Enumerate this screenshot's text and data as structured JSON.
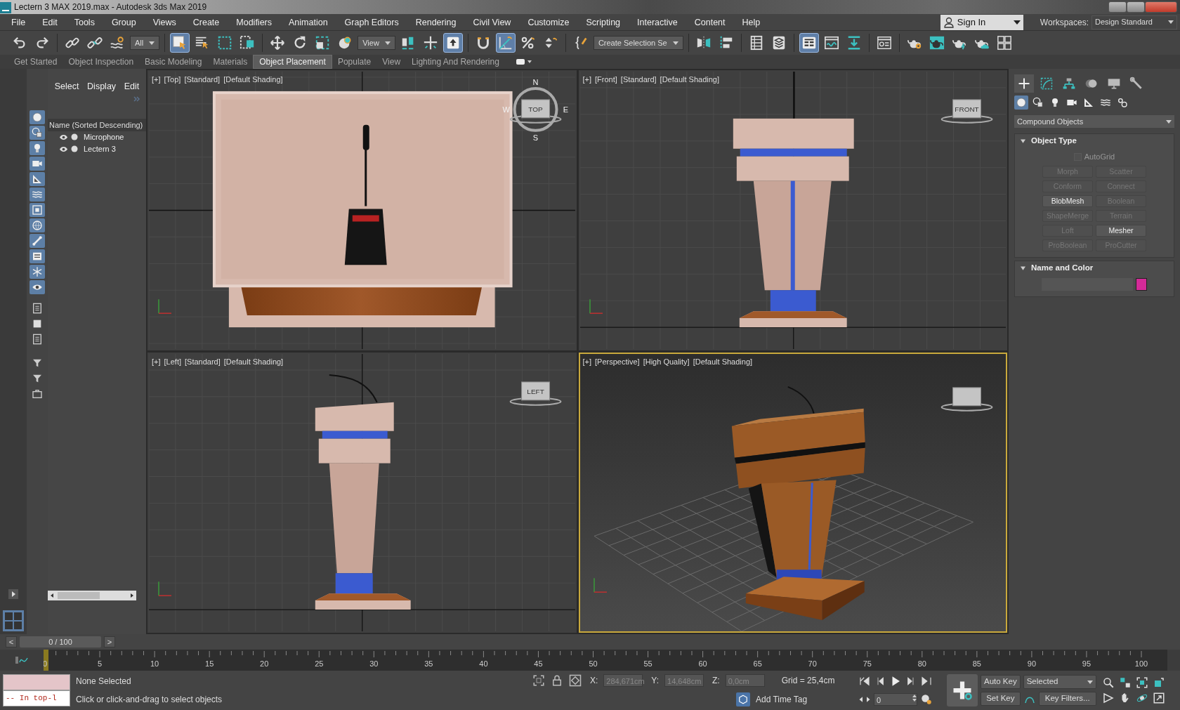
{
  "window": {
    "title": "Lectern 3 MAX 2019.max - Autodesk 3ds Max 2019"
  },
  "menu_bar": [
    "File",
    "Edit",
    "Tools",
    "Group",
    "Views",
    "Create",
    "Modifiers",
    "Animation",
    "Graph Editors",
    "Rendering",
    "Civil View",
    "Customize",
    "Scripting",
    "Interactive",
    "Content",
    "Help"
  ],
  "sign_in": {
    "label": "Sign In"
  },
  "workspaces": {
    "label": "Workspaces:",
    "value": "Design Standard"
  },
  "main_toolbar": [
    [
      {
        "kind": "undo",
        "active": false
      },
      {
        "kind": "redo",
        "active": false
      }
    ],
    [
      {
        "kind": "link",
        "active": false
      },
      {
        "kind": "unlink",
        "active": false
      },
      {
        "kind": "bind",
        "active": false
      },
      {
        "kind": "dropdown",
        "value": "All",
        "active": false
      }
    ],
    [
      {
        "kind": "select",
        "active": true
      },
      {
        "kind": "selectname",
        "active": false
      },
      {
        "kind": "rect",
        "active": false
      },
      {
        "kind": "crossing",
        "active": false
      }
    ],
    [
      {
        "kind": "move",
        "active": false
      },
      {
        "kind": "rotate",
        "active": false
      },
      {
        "kind": "scale",
        "active": false
      },
      {
        "kind": "place",
        "active": false
      },
      {
        "kind": "dropdown",
        "value": "View",
        "active": false
      },
      {
        "kind": "pivot",
        "active": false
      },
      {
        "kind": "manip",
        "active": false
      },
      {
        "kind": "shortcut",
        "active": true
      }
    ],
    [
      {
        "kind": "snap",
        "active": false
      },
      {
        "kind": "angle",
        "active": true
      },
      {
        "kind": "percent",
        "active": false
      },
      {
        "kind": "spinner",
        "active": false
      }
    ],
    [
      {
        "kind": "named",
        "active": false
      },
      {
        "kind": "dropdown",
        "value": "Create Selection Se",
        "active": false
      }
    ],
    [
      {
        "kind": "mirror",
        "active": false
      },
      {
        "kind": "align",
        "active": false
      }
    ],
    [
      {
        "kind": "table",
        "active": false
      },
      {
        "kind": "layers",
        "active": false
      }
    ],
    [
      {
        "kind": "ribbon",
        "active": true
      },
      {
        "kind": "curve",
        "active": false
      },
      {
        "kind": "dope",
        "active": false
      }
    ],
    [
      {
        "kind": "matedit",
        "active": false
      }
    ],
    [
      {
        "kind": "rendersetup",
        "active": false
      },
      {
        "kind": "framewindow",
        "active": false
      },
      {
        "kind": "render",
        "active": false
      },
      {
        "kind": "cloud",
        "active": false
      },
      {
        "kind": "browser",
        "active": false
      }
    ]
  ],
  "ribbon_tabs": [
    {
      "label": "Get Started",
      "selected": false
    },
    {
      "label": "Object Inspection",
      "selected": false
    },
    {
      "label": "Basic Modeling",
      "selected": false
    },
    {
      "label": "Materials",
      "selected": false
    },
    {
      "label": "Object Placement",
      "selected": true
    },
    {
      "label": "Populate",
      "selected": false
    },
    {
      "label": "View",
      "selected": false
    },
    {
      "label": "Lighting And Rendering",
      "selected": false
    }
  ],
  "left_strip": [
    {
      "kind": "geometry",
      "on": true
    },
    {
      "kind": "shapes",
      "on": true
    },
    {
      "kind": "lights",
      "on": true
    },
    {
      "kind": "cameras",
      "on": true
    },
    {
      "kind": "helpers",
      "on": true
    },
    {
      "kind": "spacewarps",
      "on": true
    },
    {
      "kind": "groups",
      "on": true
    },
    {
      "kind": "xrefs",
      "on": true
    },
    {
      "kind": "bones",
      "on": true
    },
    {
      "kind": "containers",
      "on": true
    },
    {
      "kind": "particles",
      "on": true
    },
    {
      "kind": "hidden",
      "on": true
    },
    {
      "kind": "doc",
      "on": false
    },
    {
      "kind": "square",
      "on": false
    },
    {
      "kind": "doc",
      "on": false
    },
    {
      "kind": "filter",
      "on": false
    },
    {
      "kind": "filter",
      "on": false
    },
    {
      "kind": "container",
      "on": false
    }
  ],
  "scene_explorer": {
    "menus": [
      "Select",
      "Display",
      "Edit"
    ],
    "header": "Name (Sorted Descending)",
    "items": [
      {
        "name": "Microphone",
        "visible": true,
        "selected": false
      },
      {
        "name": "Lectern 3",
        "visible": true,
        "selected": false
      }
    ]
  },
  "viewports": [
    {
      "kind": "top",
      "labels": [
        "[+]",
        "[Top]",
        "[Standard]",
        "[Default Shading]"
      ],
      "active": false,
      "viewcube": "TOP",
      "compass": [
        "N",
        "W",
        "E",
        "S"
      ]
    },
    {
      "kind": "front",
      "labels": [
        "[+]",
        "[Front]",
        "[Standard]",
        "[Default Shading]"
      ],
      "active": false,
      "viewcube": "FRONT"
    },
    {
      "kind": "left",
      "labels": [
        "[+]",
        "[Left]",
        "[Standard]",
        "[Default Shading]"
      ],
      "active": false,
      "viewcube": "LEFT"
    },
    {
      "kind": "perspective",
      "labels": [
        "[+]",
        "[Perspective]",
        "[High Quality]",
        "[Default Shading]"
      ],
      "active": true
    }
  ],
  "command_panel": {
    "tabs": [
      {
        "kind": "create",
        "selected": true
      },
      {
        "kind": "modify",
        "selected": false
      },
      {
        "kind": "hierarchy",
        "selected": false
      },
      {
        "kind": "motion",
        "selected": false
      },
      {
        "kind": "display",
        "selected": false
      },
      {
        "kind": "utilities",
        "selected": false
      }
    ],
    "categories": [
      {
        "kind": "geometry",
        "selected": true
      },
      {
        "kind": "shapes",
        "selected": false
      },
      {
        "kind": "lights",
        "selected": false
      },
      {
        "kind": "cameras",
        "selected": false
      },
      {
        "kind": "helpers",
        "selected": false
      },
      {
        "kind": "spacewarps",
        "selected": false
      },
      {
        "kind": "systems",
        "selected": false
      }
    ],
    "type_dropdown": "Compound Objects",
    "object_type": {
      "title": "Object Type",
      "expanded": true,
      "autogrid": {
        "label": "AutoGrid",
        "checked": false,
        "disabled": true
      },
      "buttons": [
        {
          "label": "Morph",
          "disabled": true
        },
        {
          "label": "Scatter",
          "disabled": true
        },
        {
          "label": "Conform",
          "disabled": true
        },
        {
          "label": "Connect",
          "disabled": true
        },
        {
          "label": "BlobMesh",
          "disabled": false
        },
        {
          "label": "Boolean",
          "disabled": true
        },
        {
          "label": "ShapeMerge",
          "disabled": true
        },
        {
          "label": "Terrain",
          "disabled": true
        },
        {
          "label": "Loft",
          "disabled": true
        },
        {
          "label": "Mesher",
          "disabled": false
        },
        {
          "label": "ProBoolean",
          "disabled": true
        },
        {
          "label": "ProCutter",
          "disabled": true
        }
      ]
    },
    "name_and_color": {
      "title": "Name and Color",
      "expanded": true,
      "color": "#d42a98"
    }
  },
  "time_slider": {
    "prev": "<",
    "position": "0 / 100",
    "next": ">"
  },
  "timeline": {
    "frames": [
      "0",
      "5",
      "10",
      "15",
      "20",
      "25",
      "30",
      "35",
      "40",
      "45",
      "50",
      "55",
      "60",
      "65",
      "70",
      "75",
      "80",
      "85",
      "90",
      "95",
      "100"
    ]
  },
  "status": {
    "listener": "--  In top-l",
    "prompt": "None Selected",
    "hint": "Click or click-and-drag to select objects",
    "coords": [
      {
        "label": "X:",
        "value": "284,671cm"
      },
      {
        "label": "Y:",
        "value": "14,648cm"
      },
      {
        "label": "Z:",
        "value": "0,0cm"
      }
    ],
    "grid": "Grid = 25,4cm",
    "time_tag": "Add Time Tag",
    "frame": "0",
    "auto_key": {
      "label": "Auto Key",
      "on": false
    },
    "set_key": "Set Key",
    "key_set": "Selected",
    "key_filters": "Key Filters..."
  }
}
